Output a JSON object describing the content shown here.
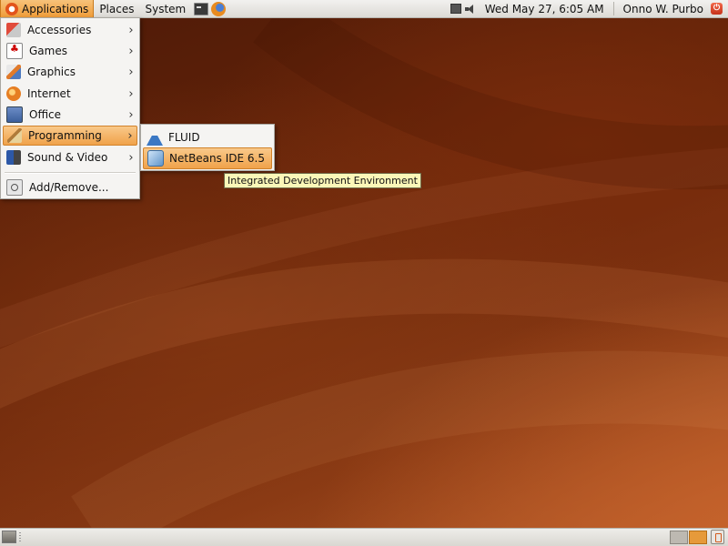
{
  "top_panel": {
    "menus": [
      {
        "label": "Applications"
      },
      {
        "label": "Places"
      },
      {
        "label": "System"
      }
    ],
    "launchers": [
      {
        "icon": "terminal-icon"
      },
      {
        "icon": "firefox-icon"
      }
    ],
    "clock": "Wed May 27,  6:05 AM",
    "user": "Onno W. Purbo"
  },
  "applications_menu": {
    "items": [
      {
        "label": "Accessories",
        "icon": "accessories-icon",
        "submenu": true
      },
      {
        "label": "Games",
        "icon": "games-icon",
        "submenu": true
      },
      {
        "label": "Graphics",
        "icon": "graphics-icon",
        "submenu": true
      },
      {
        "label": "Internet",
        "icon": "internet-icon",
        "submenu": true
      },
      {
        "label": "Office",
        "icon": "office-icon",
        "submenu": true
      },
      {
        "label": "Programming",
        "icon": "programming-icon",
        "submenu": true,
        "active": true
      },
      {
        "label": "Sound & Video",
        "icon": "sound-video-icon",
        "submenu": true
      },
      {
        "label": "Add/Remove...",
        "icon": "add-remove-icon",
        "submenu": false
      }
    ]
  },
  "programming_submenu": {
    "items": [
      {
        "label": "FLUID",
        "icon": "fluid-icon"
      },
      {
        "label": "NetBeans IDE 6.5",
        "icon": "netbeans-icon",
        "active": true
      }
    ]
  },
  "tooltip": {
    "text": "Integrated Development Environment"
  },
  "bottom_panel": {
    "workspaces": [
      {
        "active": false
      },
      {
        "active": true
      }
    ]
  },
  "colors": {
    "highlight": "#f0a24a",
    "desktop_base": "#6a260a",
    "tooltip_bg": "#fbf7b8"
  }
}
